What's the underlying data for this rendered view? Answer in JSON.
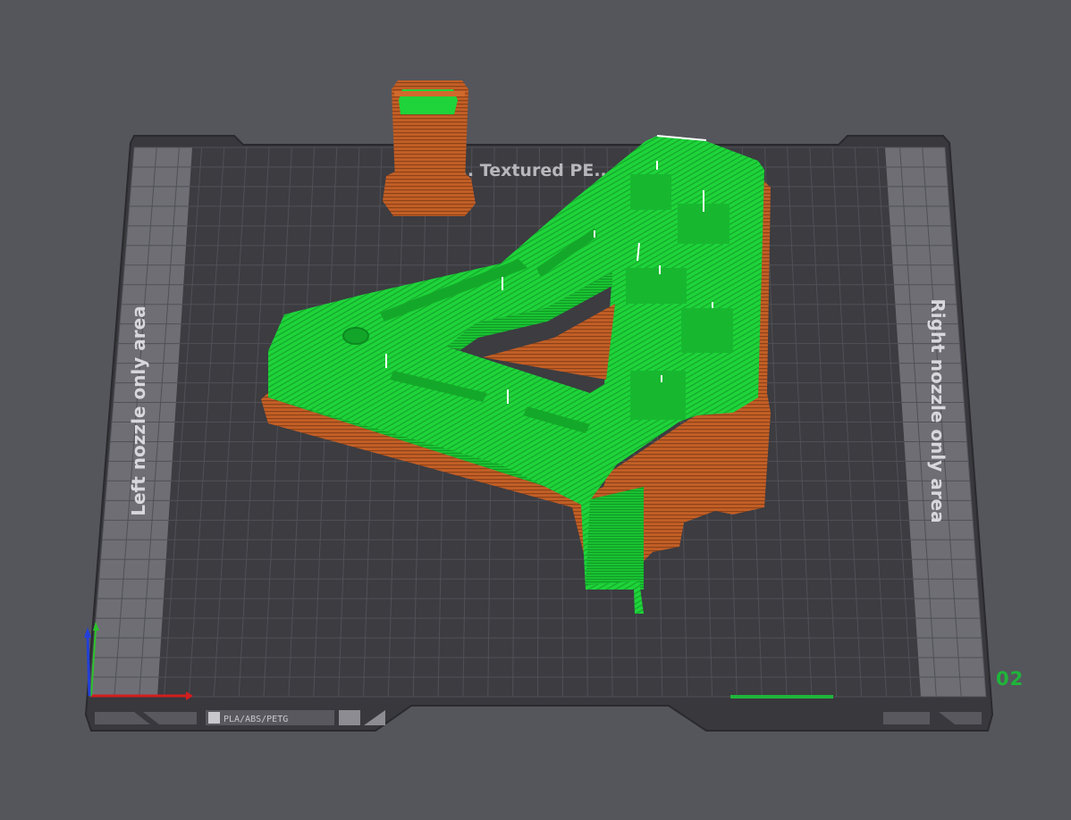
{
  "plate": {
    "bed_label": "B... Textured PE...",
    "left_area_label": "Left nozzle only area",
    "right_area_label": "Right nozzle only area",
    "plate_number": "02",
    "filament_badge": "PLA/ABS/PETG"
  },
  "colors": {
    "background": "#55565c",
    "bed_frame": "#38383d",
    "bed_surface": "#3c3c41",
    "exclusion_zone": "#6e6e74",
    "model_top": "#1ed43a",
    "model_side": "#c35f26",
    "axis_x": "#d21e1e",
    "axis_y": "#2bc22b",
    "axis_z": "#2340d8",
    "plate_number": "#1fb53a"
  },
  "icons": {
    "plate-logo-icon": "bambu-logo",
    "plate-lock-icon": "lock",
    "plate-arrow-icon": "triangle"
  }
}
